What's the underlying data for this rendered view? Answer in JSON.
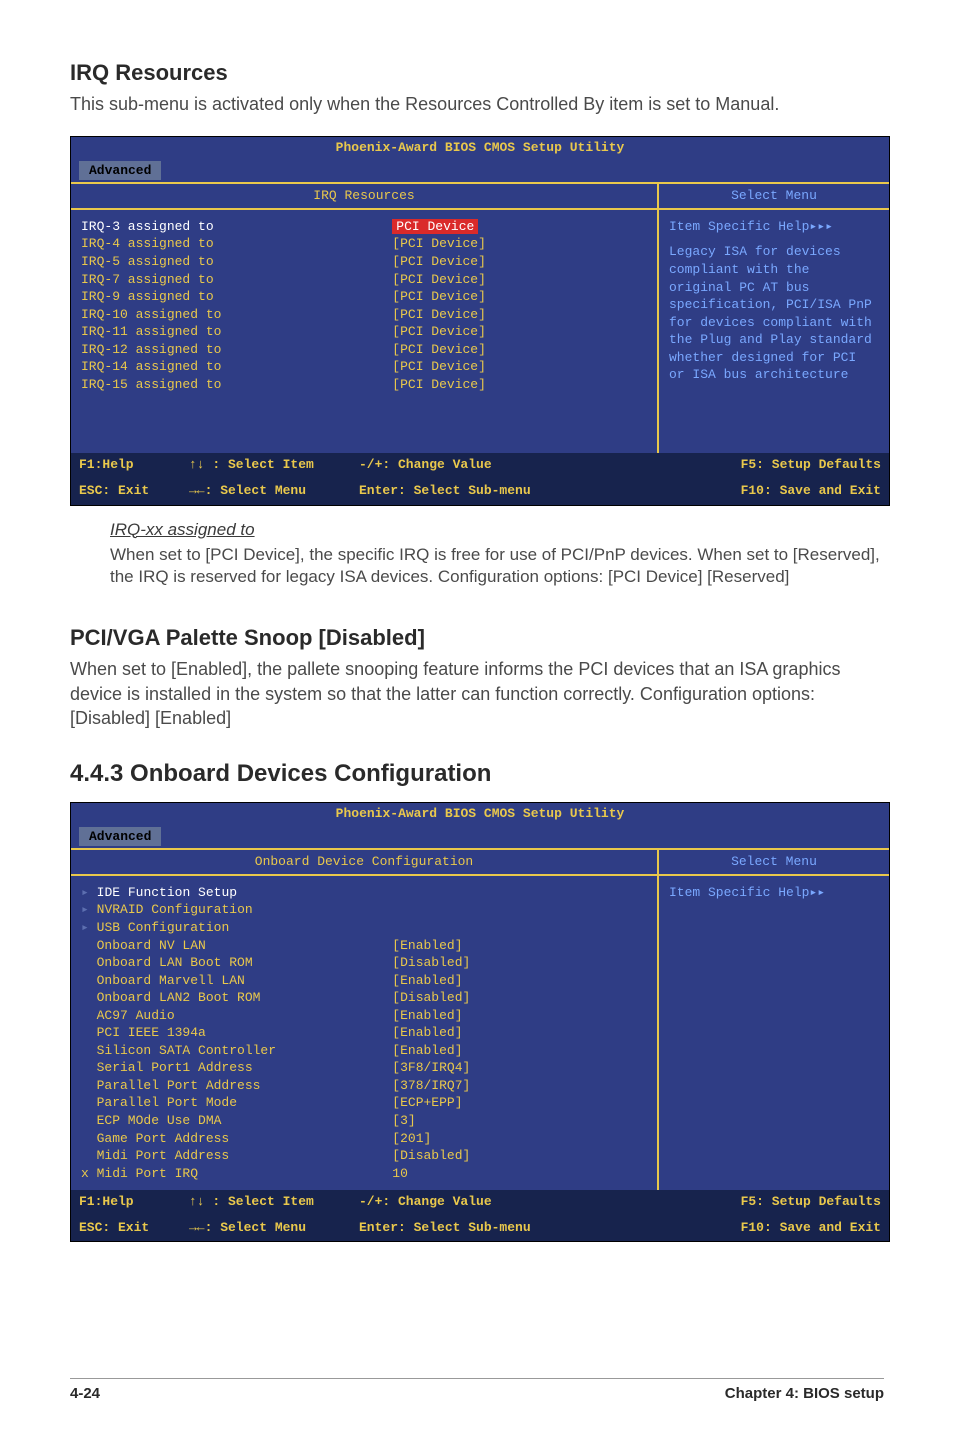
{
  "section1": {
    "title": "IRQ Resources",
    "intro": "This sub-menu is activated only when the Resources Controlled By item is set to Manual."
  },
  "bios1": {
    "title": "Phoenix-Award BIOS CMOS Setup Utility",
    "tab": "Advanced",
    "left_title": "IRQ Resources",
    "right_title": "Select Menu",
    "rows": [
      {
        "label": "IRQ-3 assigned to",
        "val": "PCI Device",
        "selected": true
      },
      {
        "label": "IRQ-4 assigned to",
        "val": "[PCI Device]"
      },
      {
        "label": "IRQ-5 assigned to",
        "val": "[PCI Device]"
      },
      {
        "label": "IRQ-7 assigned to",
        "val": "[PCI Device]"
      },
      {
        "label": "IRQ-9 assigned to",
        "val": "[PCI Device]"
      },
      {
        "label": "IRQ-10 assigned to",
        "val": "[PCI Device]"
      },
      {
        "label": "IRQ-11 assigned to",
        "val": "[PCI Device]"
      },
      {
        "label": "IRQ-12 assigned to",
        "val": "[PCI Device]"
      },
      {
        "label": "IRQ-14 assigned to",
        "val": "[PCI Device]"
      },
      {
        "label": "IRQ-15 assigned to",
        "val": "[PCI Device]"
      }
    ],
    "help_title": "Item Specific Help▸▸▸",
    "help_body": "Legacy ISA for devices compliant with the original PC AT bus specification, PCI/ISA PnP for devices compliant with the Plug and Play standard whether designed for PCI or ISA bus architecture",
    "footer": {
      "l1a": "F1:Help",
      "l1b": "↑↓ : Select Item",
      "l1c": "-/+: Change Value",
      "l1d": "F5: Setup Defaults",
      "l2a": "ESC: Exit",
      "l2b": "→←: Select Menu",
      "l2c": "Enter: Select Sub-menu",
      "l2d": "F10: Save and Exit"
    }
  },
  "irq_assigned": {
    "heading": "IRQ-xx assigned to",
    "body": "When set to [PCI Device], the specific IRQ is free for use of PCI/PnP devices. When set to [Reserved], the IRQ is reserved for legacy ISA devices. Configuration options: [PCI Device] [Reserved]"
  },
  "section2": {
    "title": "PCI/VGA Palette Snoop [Disabled]",
    "body": "When set to [Enabled], the pallete snooping feature informs the PCI devices that an ISA graphics device is installed in the system so that the latter can function correctly. Configuration options: [Disabled] [Enabled]"
  },
  "section3": {
    "title": "4.4.3   Onboard Devices Configuration"
  },
  "bios2": {
    "title": "Phoenix-Award BIOS CMOS Setup Utility",
    "tab": "Advanced",
    "left_title": "Onboard Device Configuration",
    "right_title": "Select Menu",
    "rows": [
      {
        "label": "IDE Function Setup",
        "val": "",
        "submenu": true,
        "selected": true
      },
      {
        "label": "NVRAID Configuration",
        "val": "",
        "submenu": true
      },
      {
        "label": "USB Configuration",
        "val": "",
        "submenu": true
      },
      {
        "label": "Onboard NV LAN",
        "val": "[Enabled]"
      },
      {
        "label": "Onboard LAN Boot ROM",
        "val": "[Disabled]"
      },
      {
        "label": "Onboard Marvell LAN",
        "val": "[Enabled]"
      },
      {
        "label": "Onboard LAN2 Boot ROM",
        "val": "[Disabled]"
      },
      {
        "label": "AC97 Audio",
        "val": "[Enabled]"
      },
      {
        "label": "PCI IEEE 1394a",
        "val": "[Enabled]"
      },
      {
        "label": "Silicon SATA Controller",
        "val": "[Enabled]"
      },
      {
        "label": "Serial Port1 Address",
        "val": "[3F8/IRQ4]"
      },
      {
        "label": "Parallel Port Address",
        "val": "[378/IRQ7]"
      },
      {
        "label": "Parallel Port Mode",
        "val": "[ECP+EPP]"
      },
      {
        "label": "ECP MOde Use DMA",
        "val": "[3]"
      },
      {
        "label": "Game Port Address",
        "val": "[201]"
      },
      {
        "label": "Midi Port Address",
        "val": "[Disabled]"
      },
      {
        "label": "Midi Port IRQ",
        "val": "10",
        "x": true
      }
    ],
    "help_title": "Item Specific Help▸▸",
    "footer": {
      "l1a": "F1:Help",
      "l1b": "↑↓ : Select Item",
      "l1c": "-/+: Change Value",
      "l1d": "F5: Setup Defaults",
      "l2a": "ESC: Exit",
      "l2b": "→←: Select Menu",
      "l2c": "Enter: Select Sub-menu",
      "l2d": "F10: Save and Exit"
    }
  },
  "page_footer": {
    "page": "4-24",
    "chapter": "Chapter 4: BIOS setup"
  }
}
